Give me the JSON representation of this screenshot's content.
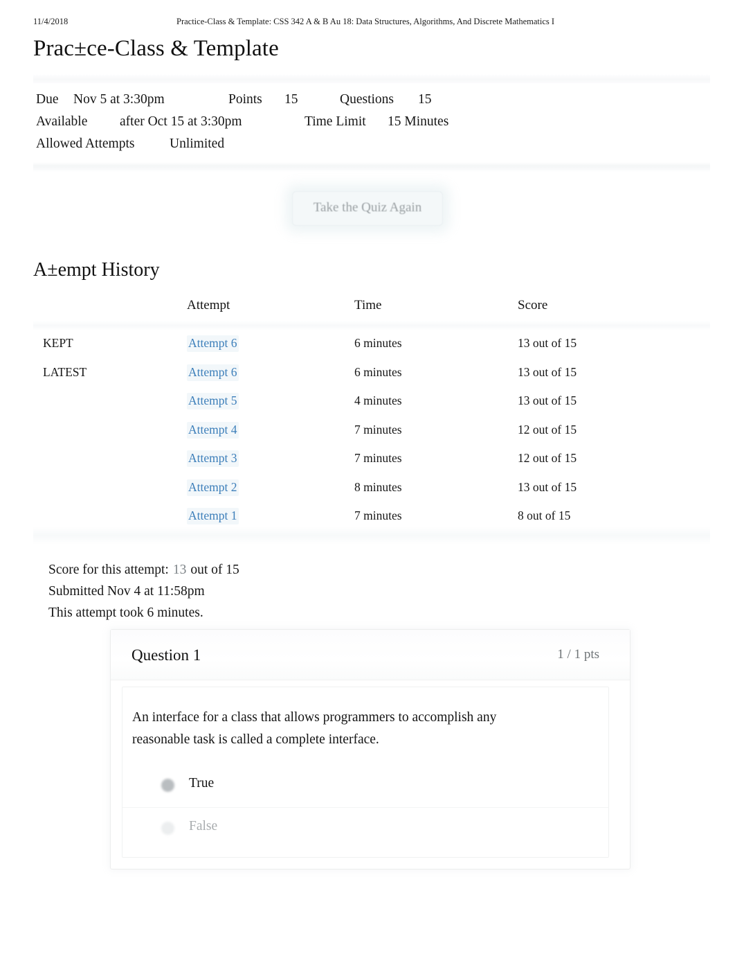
{
  "print_header": {
    "date": "11/4/2018",
    "document_title": "Practice-Class & Template: CSS 342 A & B Au 18: Data Structures, Algorithms, And Discrete Mathematics I"
  },
  "page_title": "Prac±ce-Class & Template",
  "quiz_meta": {
    "due_label": "Due",
    "due_value": "Nov 5 at 3:30pm",
    "points_label": "Points",
    "points_value": "15",
    "questions_label": "Questions",
    "questions_value": "15",
    "available_label": "Available",
    "available_value": "after Oct 15 at 3:30pm",
    "time_limit_label": "Time Limit",
    "time_limit_value": "15 Minutes",
    "allowed_attempts_label": "Allowed Attempts",
    "allowed_attempts_value": "Unlimited"
  },
  "retake_button": {
    "label": "Take the Quiz Again"
  },
  "attempt_history": {
    "heading": "A±empt History",
    "columns": {
      "kind": "",
      "attempt": "Attempt",
      "time": "Time",
      "score": "Score"
    },
    "rows": [
      {
        "kind": "KEPT",
        "attempt": "Attempt 6",
        "time": "6 minutes",
        "score": "13 out of 15"
      },
      {
        "kind": "LATEST",
        "attempt": "Attempt 6",
        "time": "6 minutes",
        "score": "13 out of 15"
      },
      {
        "kind": "",
        "attempt": "Attempt 5",
        "time": "4 minutes",
        "score": "13 out of 15"
      },
      {
        "kind": "",
        "attempt": "Attempt 4",
        "time": "7 minutes",
        "score": "12 out of 15"
      },
      {
        "kind": "",
        "attempt": "Attempt 3",
        "time": "7 minutes",
        "score": "12 out of 15"
      },
      {
        "kind": "",
        "attempt": "Attempt 2",
        "time": "8 minutes",
        "score": "13 out of 15"
      },
      {
        "kind": "",
        "attempt": "Attempt 1",
        "time": "7 minutes",
        "score": "8 out of 15"
      }
    ]
  },
  "score_summary": {
    "score_label": "Score for this attempt:",
    "score_value": "13",
    "score_suffix": "out of 15",
    "submitted": "Submitted Nov 4 at 11:58pm",
    "duration": "This attempt took 6 minutes."
  },
  "question": {
    "name": "Question 1",
    "points": "1 / 1 pts",
    "text": "An interface for a class that allows programmers to accomplish any reasonable task is called a complete interface.",
    "answers": [
      {
        "label": "True",
        "selected": true
      },
      {
        "label": "False",
        "selected": false
      }
    ]
  },
  "colors": {
    "link_blue": "#3d7fba",
    "muted_text": "#9aa0a3",
    "body_text": "#161616",
    "page_background": "#ffffff"
  }
}
